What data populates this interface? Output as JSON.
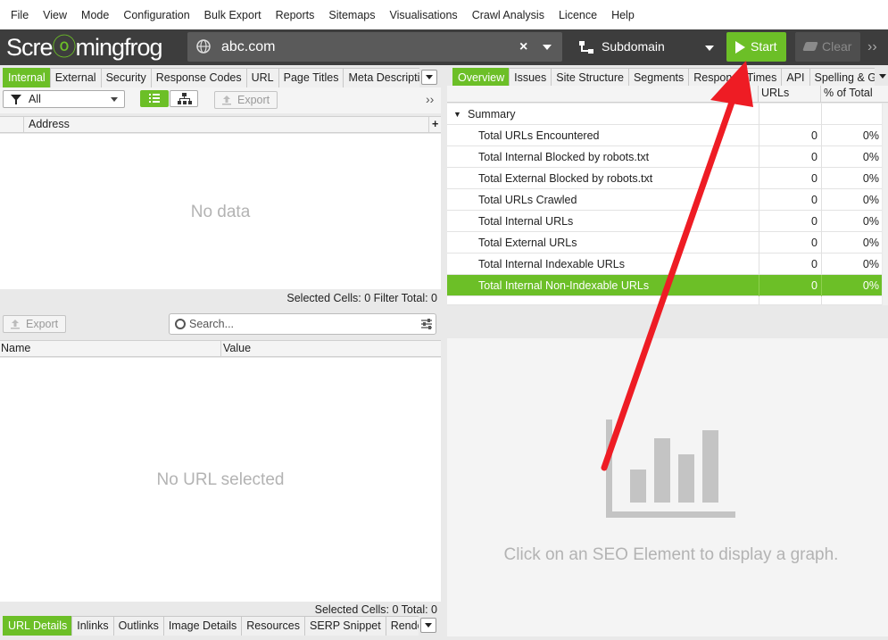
{
  "menu": [
    "File",
    "View",
    "Mode",
    "Configuration",
    "Bulk Export",
    "Reports",
    "Sitemaps",
    "Visualisations",
    "Crawl Analysis",
    "Licence",
    "Help"
  ],
  "toolbar": {
    "logo_a": "Scre",
    "logo_b": "mingfrog",
    "url": "abc.com",
    "clear_x": "×",
    "mode": "Subdomain",
    "start_label": "Start",
    "clear_label": "Clear",
    "more": "››"
  },
  "left_tabs": [
    "Internal",
    "External",
    "Security",
    "Response Codes",
    "URL",
    "Page Titles",
    "Meta Description"
  ],
  "left_tools": {
    "filter": "All",
    "export": "Export",
    "more": "››"
  },
  "address_header": "Address",
  "add_col": "+",
  "left_empty": "No data",
  "left_status": "Selected Cells:  0  Filter Total:  0",
  "right_tabs": [
    "Overview",
    "Issues",
    "Site Structure",
    "Segments",
    "Response Times",
    "API",
    "Spelling & Grammar"
  ],
  "overview": {
    "col_urls": "URLs",
    "col_pct": "% of Total",
    "summary_label": "Summary",
    "rows": [
      {
        "label": "Total URLs Encountered",
        "urls": "0",
        "pct": "0%"
      },
      {
        "label": "Total Internal Blocked by robots.txt",
        "urls": "0",
        "pct": "0%"
      },
      {
        "label": "Total External Blocked by robots.txt",
        "urls": "0",
        "pct": "0%"
      },
      {
        "label": "Total URLs Crawled",
        "urls": "0",
        "pct": "0%"
      },
      {
        "label": "Total Internal URLs",
        "urls": "0",
        "pct": "0%"
      },
      {
        "label": "Total External URLs",
        "urls": "0",
        "pct": "0%"
      },
      {
        "label": "Total Internal Indexable URLs",
        "urls": "0",
        "pct": "0%"
      },
      {
        "label": "Total Internal Non-Indexable URLs",
        "urls": "0",
        "pct": "0%"
      }
    ]
  },
  "lower_left": {
    "export": "Export",
    "search_placeholder": "Search...",
    "col_name": "Name",
    "col_value": "Value",
    "empty": "No URL selected",
    "status": "Selected Cells:  0  Total:  0"
  },
  "bottom_tabs": [
    "URL Details",
    "Inlinks",
    "Outlinks",
    "Image Details",
    "Resources",
    "SERP Snippet",
    "Rendered Page"
  ],
  "graph_message": "Click on an SEO Element to display a graph.",
  "colors": {
    "accent": "#6cbf27",
    "toolbar_bg": "#3d3d3d",
    "arrow": "#ee1c24"
  }
}
